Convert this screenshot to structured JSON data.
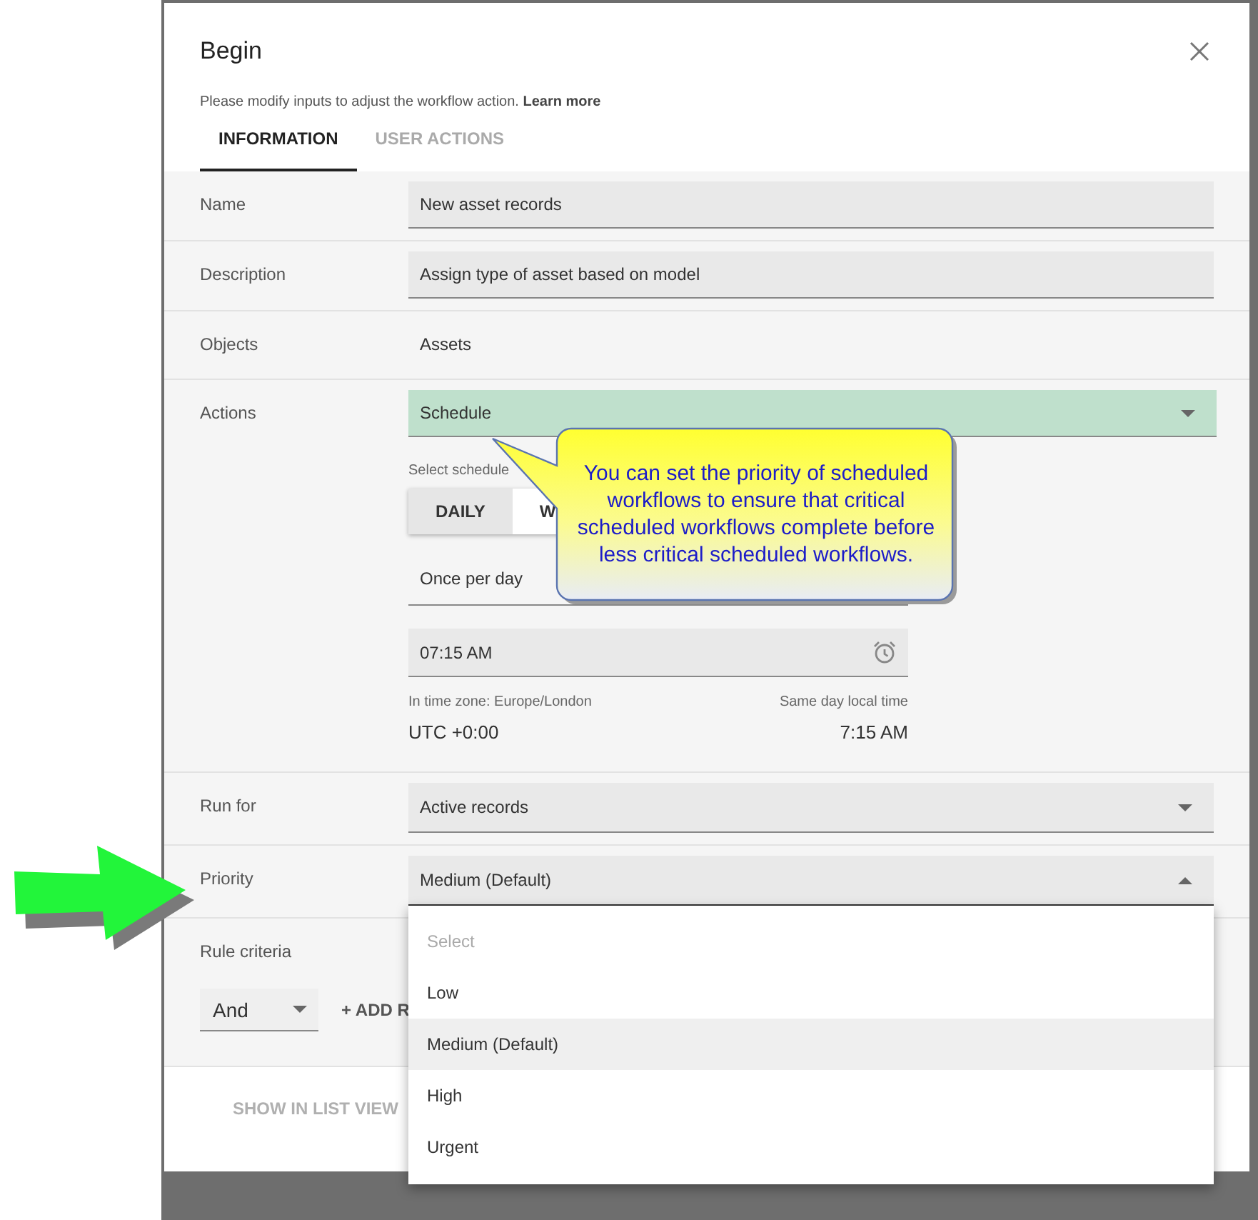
{
  "dialog": {
    "title": "Begin",
    "subtitle": "Please modify inputs to adjust the workflow action.",
    "learn_more": "Learn more",
    "tabs": [
      {
        "label": "INFORMATION",
        "selected": true
      },
      {
        "label": "USER ACTIONS",
        "selected": false
      }
    ],
    "rows": [
      {
        "kind": "input",
        "label": "Name",
        "value": "New asset records"
      },
      {
        "kind": "input",
        "label": "Description",
        "value": "Assign type of asset based on model"
      },
      {
        "kind": "static",
        "label": "Objects",
        "value": "Assets"
      },
      {
        "kind": "schedule",
        "label": "Actions",
        "value": "Schedule",
        "highlighted": true,
        "schedule_label": "Select schedule",
        "schedule_tabs": [
          {
            "label": "DAILY",
            "selected": true
          },
          {
            "label": "W",
            "selected": false
          }
        ],
        "frequency": "Once per day",
        "time": "07:15 AM",
        "timezone_label": "In time zone: Europe/London",
        "local_label": "Same day local time",
        "utc_offset": "UTC +0:00",
        "local_time": "7:15 AM"
      },
      {
        "kind": "select",
        "label": "Run for",
        "value": "Active records",
        "expanded": false
      },
      {
        "kind": "select",
        "label": "Priority",
        "value": "Medium (Default)",
        "expanded": true,
        "prompt": "Select",
        "options": [
          {
            "label": "Low",
            "selected": false
          },
          {
            "label": "Medium (Default)",
            "selected": true
          },
          {
            "label": "High",
            "selected": false
          },
          {
            "label": "Urgent",
            "selected": false
          }
        ]
      },
      {
        "kind": "rule",
        "label": "Rule criteria",
        "operator": "And",
        "add_button": "+ ADD R"
      }
    ],
    "footer": {
      "button": "SHOW IN LIST VIEW",
      "disabled": true
    }
  },
  "callout": {
    "text": "You can set the priority of scheduled workflows to ensure that critical scheduled workflows complete before less critical scheduled workflows."
  }
}
